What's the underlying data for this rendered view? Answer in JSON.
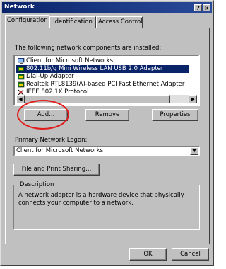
{
  "window": {
    "title": "Network",
    "help_btn": "?",
    "close_btn": "×"
  },
  "tabs": [
    {
      "label": "Configuration"
    },
    {
      "label": "Identification"
    },
    {
      "label": "Access Control"
    }
  ],
  "components": {
    "header": "The following network components are installed:",
    "items": [
      {
        "label": "Client for Microsoft Networks",
        "icon": "client-icon"
      },
      {
        "label": "802.11b/g Mini Wireless LAN USB 2.0 Adapter",
        "icon": "adapter-icon",
        "selected": true
      },
      {
        "label": "Dial-Up Adapter",
        "icon": "adapter-icon"
      },
      {
        "label": "Realtek RTL8139(A)-based PCI Fast Ethernet Adapter",
        "icon": "adapter-icon"
      },
      {
        "label": "IEEE 802.1X Protocol",
        "icon": "protocol-icon"
      }
    ]
  },
  "buttons": {
    "add": "Add...",
    "remove": "Remove",
    "properties": "Properties",
    "file_print": "File and Print Sharing...",
    "ok": "OK",
    "cancel": "Cancel"
  },
  "logon": {
    "label": "Primary Network Logon:",
    "value": "Client for Microsoft Networks"
  },
  "description": {
    "legend": "Description",
    "text": "A network adapter is a hardware device that physically connects your computer to a network."
  },
  "colors": {
    "title_bar": "#0a246a",
    "selection": "#0a246a",
    "highlight_circle": "#e21b1b"
  }
}
